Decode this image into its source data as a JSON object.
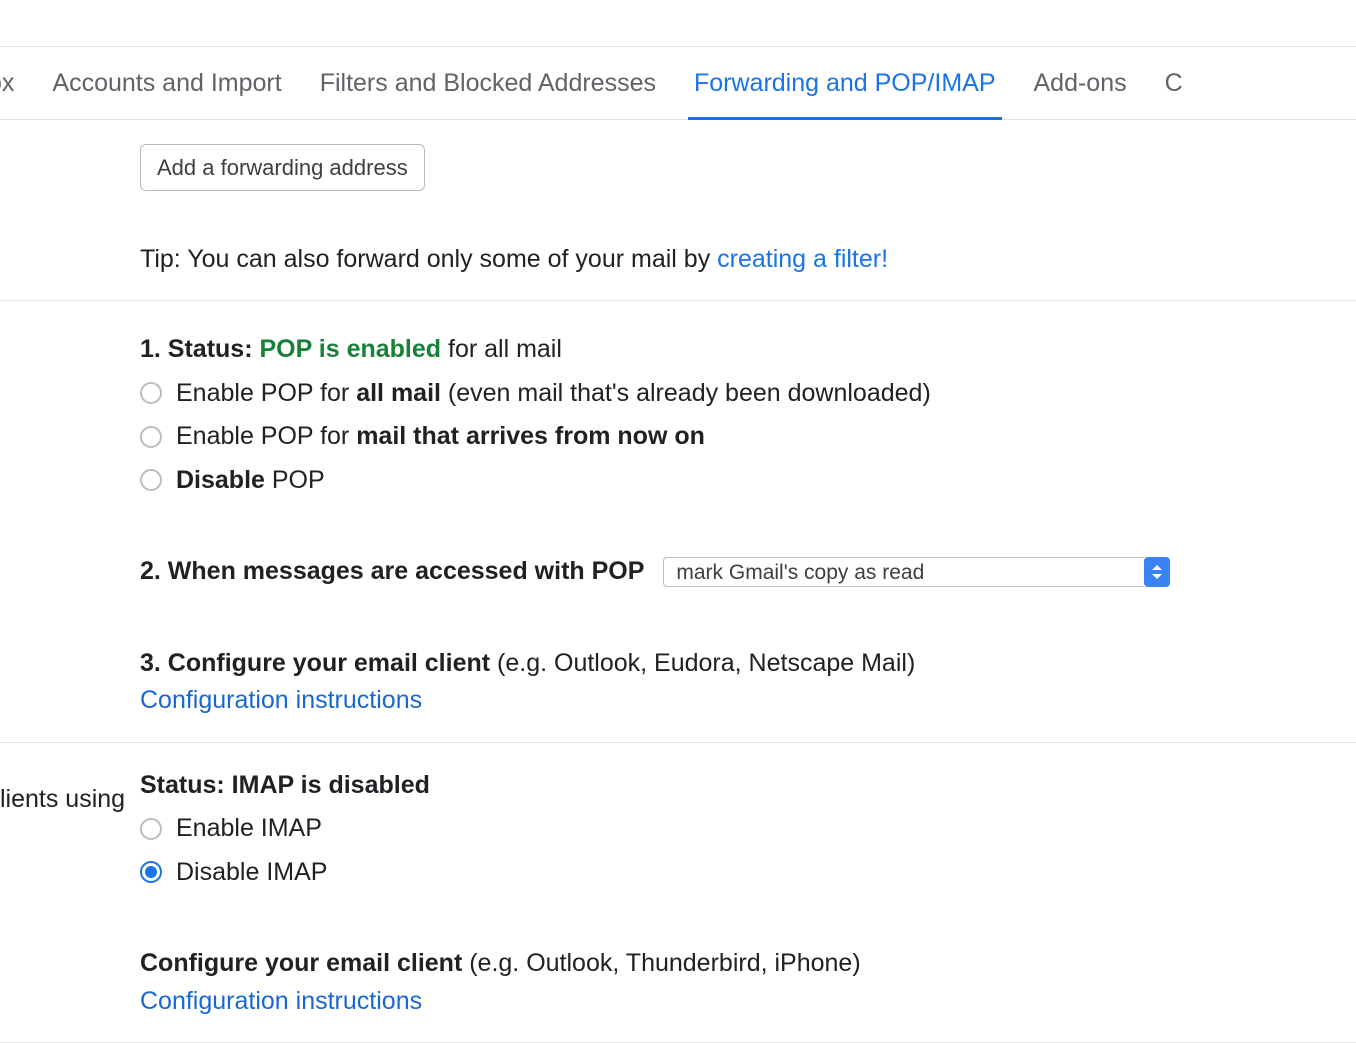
{
  "tabs": {
    "partial_left": "ox",
    "accounts": "Accounts and Import",
    "filters": "Filters and Blocked Addresses",
    "forwarding": "Forwarding and POP/IMAP",
    "addons": "Add-ons",
    "partial_right": "C"
  },
  "forwarding": {
    "add_button": "Add a forwarding address",
    "tip_prefix": "Tip: You can also forward only some of your mail by ",
    "tip_link": "creating a filter!"
  },
  "pop": {
    "status_num": "1. Status: ",
    "status_green": "POP is enabled",
    "status_suffix": " for all mail",
    "opt_all_prefix": "Enable POP for ",
    "opt_all_bold": "all mail",
    "opt_all_suffix": " (even mail that's already been downloaded)",
    "opt_now_prefix": "Enable POP for ",
    "opt_now_bold": "mail that arrives from now on",
    "opt_disable_bold": "Disable",
    "opt_disable_suffix": " POP",
    "when_label": "2. When messages are accessed with POP",
    "when_value": "mark Gmail's copy as read",
    "config_bold": "3. Configure your email client",
    "config_suffix": " (e.g. Outlook, Eudora, Netscape Mail)",
    "config_link": "Configuration instructions"
  },
  "imap": {
    "left_fragment": "lients using",
    "status_label": "Status: IMAP is disabled",
    "opt_enable": "Enable IMAP",
    "opt_disable": "Disable IMAP",
    "config_bold": "Configure your email client",
    "config_suffix": " (e.g. Outlook, Thunderbird, iPhone)",
    "config_link": "Configuration instructions"
  }
}
